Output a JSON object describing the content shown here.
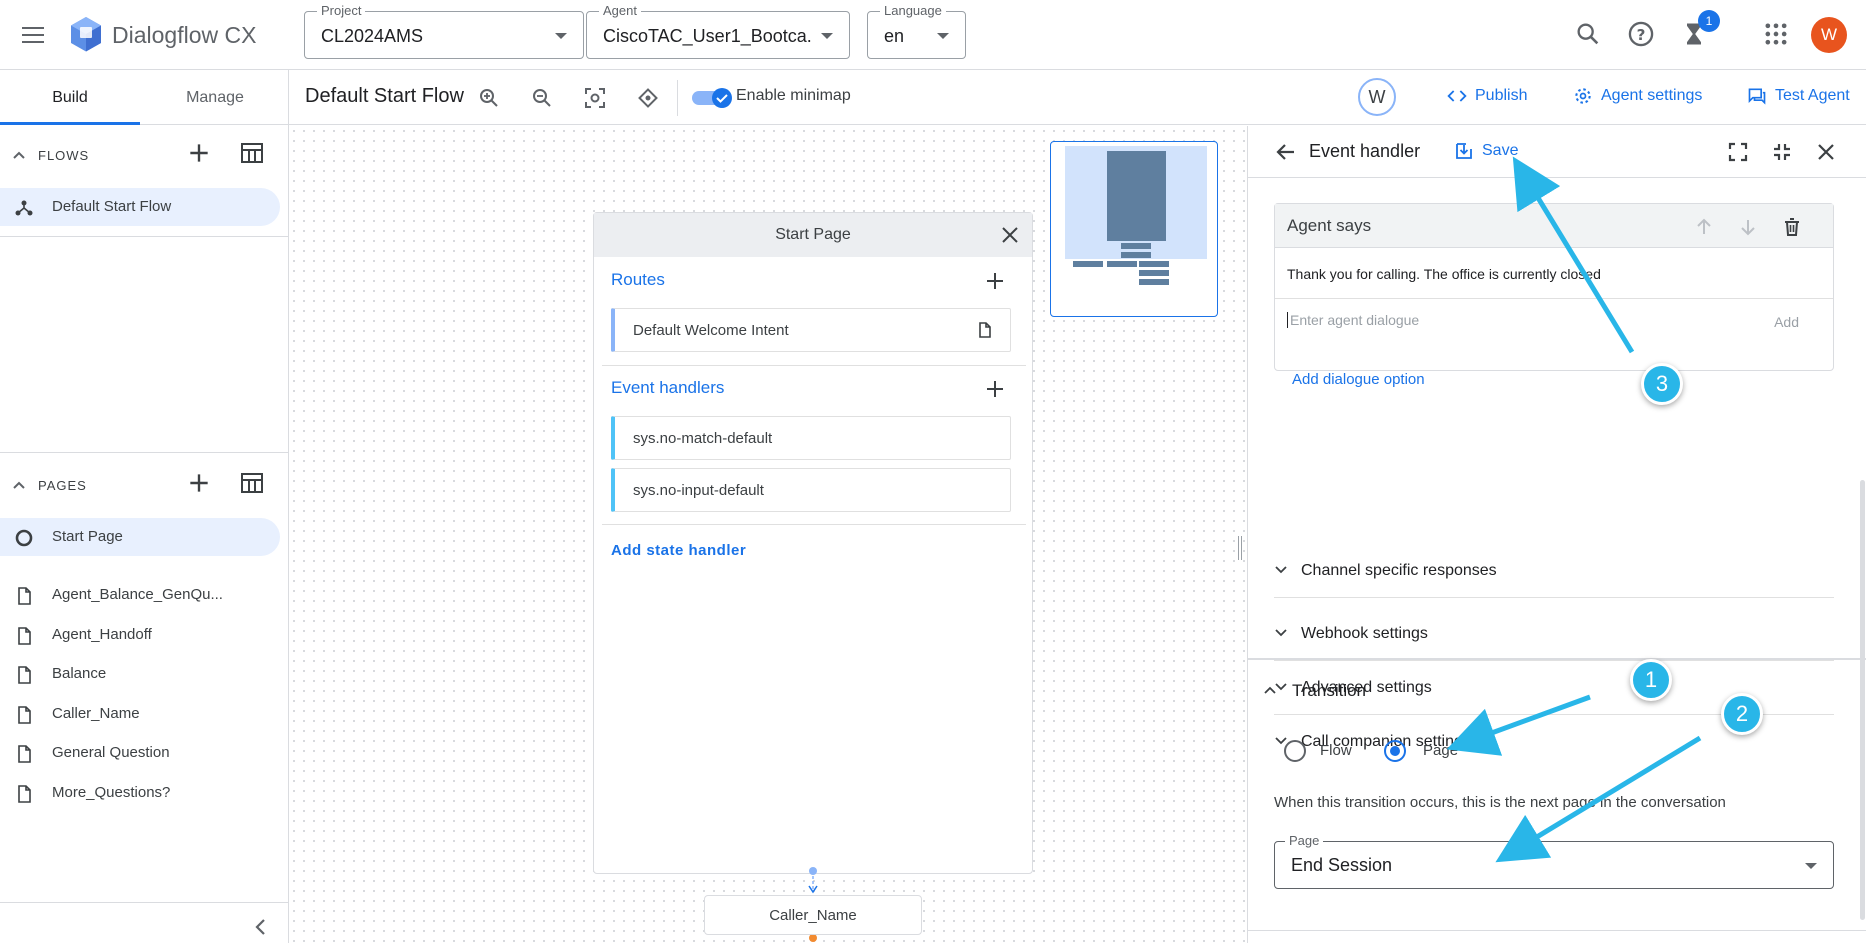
{
  "topbar": {
    "app_title": "Dialogflow CX",
    "project_label": "Project",
    "project_value": "CL2024AMS",
    "agent_label": "Agent",
    "agent_value": "CiscoTAC_User1_Bootca...",
    "language_label": "Language",
    "language_value": "en",
    "notification_count": "1",
    "user_initial": "W"
  },
  "subbar": {
    "tabs": [
      {
        "label": "Build",
        "active": true
      },
      {
        "label": "Manage",
        "active": false
      }
    ],
    "flow_title": "Default Start Flow",
    "minimap_label": "Enable minimap",
    "collaborator_initial": "W",
    "publish": "Publish",
    "agent_settings": "Agent settings",
    "test_agent": "Test Agent"
  },
  "sidebar": {
    "flows_title": "FLOWS",
    "flows": [
      "Default Start Flow"
    ],
    "pages_title": "PAGES",
    "pages": [
      "Start Page",
      "Agent_Balance_GenQu...",
      "Agent_Handoff",
      "Balance",
      "Caller_Name",
      "General Question",
      "More_Questions?"
    ]
  },
  "canvas": {
    "card_title": "Start Page",
    "routes_title": "Routes",
    "routes": [
      "Default Welcome Intent"
    ],
    "event_handlers_title": "Event handlers",
    "event_handlers": [
      "sys.no-match-default",
      "sys.no-input-default"
    ],
    "add_state_handler": "Add state handler",
    "next_node": "Caller_Name"
  },
  "panel": {
    "title": "Event handler",
    "save": "Save",
    "agent_says": "Agent says",
    "agent_text": "Thank you for calling. The office is currently closed",
    "agent_placeholder": "Enter agent dialogue",
    "add": "Add",
    "add_dialogue_option": "Add dialogue option",
    "sections": [
      "Channel specific responses",
      "Webhook settings",
      "Advanced settings",
      "Call companion settings"
    ],
    "transition_title": "Transition",
    "radio_flow": "Flow",
    "radio_page": "Page",
    "selected_target": "Page",
    "transition_desc": "When this transition occurs, this is the next page in the conversation",
    "page_label": "Page",
    "page_value": "End Session"
  },
  "annotations": [
    "1",
    "2",
    "3"
  ],
  "colors": {
    "accent": "#1a73e8",
    "callout": "#29b6e8",
    "avatar": "#e8541e"
  }
}
